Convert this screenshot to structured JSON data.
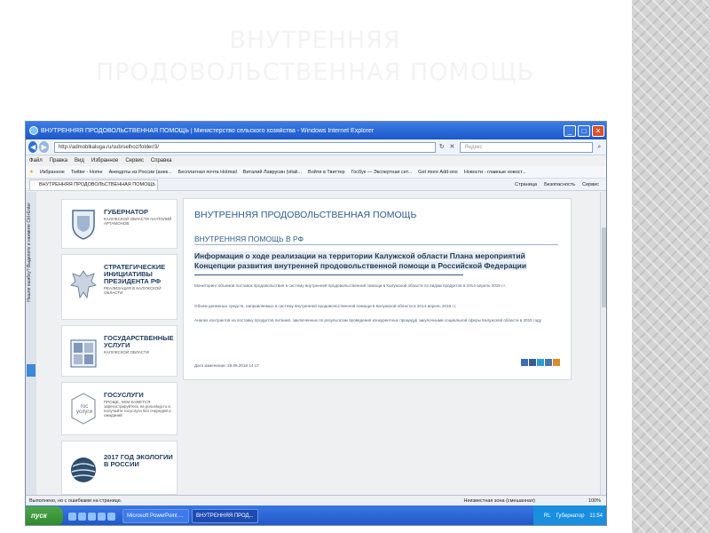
{
  "slide": {
    "title_line1": "ВНУТРЕННЯЯ",
    "title_line2": "ПРОДОВОЛЬСТВЕННАЯ ПОМОЩЬ"
  },
  "browser": {
    "window_title": "ВНУТРЕННЯЯ ПРОДОВОЛЬСТВЕННАЯ ПОМОЩЬ | Министерство сельского хозяйства - Windows Internet Explorer",
    "url": "http://admoblkaluga.ru/sub/selhoz/folder/3/",
    "search_placeholder": "Яндекс",
    "menu": [
      "Файл",
      "Правка",
      "Вид",
      "Избранное",
      "Сервис",
      "Справка"
    ],
    "favorites_label": "Избранное",
    "favorites": [
      "Twitter - Home",
      "Анекдоты из России (анек...",
      "Бесплатная почта Hotmail",
      "Виталий Лаврусин (vitali...",
      "Войти в Твиттер",
      "Госбук — Экспертная сет...",
      "Get more Add-ons",
      "Новости - главные новост..."
    ],
    "tab_label": "ВНУТРЕННЯЯ ПРОДОВОЛЬСТВЕННАЯ ПОМОЩЬ | М...",
    "tab_tools": [
      "Страница",
      "Безопасность",
      "Сервис"
    ],
    "status_text": "Выполнено, но с ошибками на странице.",
    "zone_text": "Неизвестная зона (смешанная)",
    "zoom_text": "100%"
  },
  "sidebar": {
    "vertical_text": "Нашли ошибку? Выделите и нажмите Ctrl+Enter",
    "cards": [
      {
        "heading": "ГУБЕРНАТОР",
        "sub": "КАЛУЖСКОЙ ОБЛАСТИ АНАТОЛИЙ АРТАМОНОВ"
      },
      {
        "heading": "СТРАТЕГИЧЕСКИЕ ИНИЦИАТИВЫ ПРЕЗИДЕНТА РФ",
        "sub": "РЕАЛИЗАЦИЯ В КАЛУЖСКОЙ ОБЛАСТИ"
      },
      {
        "heading": "ГОСУДАРСТВЕННЫЕ УСЛУГИ",
        "sub": "КАЛУЖСКОЙ ОБЛАСТИ"
      },
      {
        "heading": "ГОСУСЛУГИ",
        "sub": "ПРОЩЕ, ЧЕМ КАЖЕТСЯ зарегистрируйтесь на gosuslugi.ru и получайте госуслуги без очередей и ожиданий",
        "logo_text": "гос услуги"
      },
      {
        "heading": "2017 ГОД ЭКОЛОГИИ В РОССИИ",
        "sub": ""
      }
    ]
  },
  "article": {
    "page_title": "ВНУТРЕННЯЯ ПРОДОВОЛЬСТВЕННАЯ ПОМОЩЬ",
    "section_title": "ВНУТРЕННЯЯ ПОМОЩЬ В РФ",
    "headline": "Информация о ходе реализации на территории Калужской области Плана мероприятий Концепции развития внутренней продовольственной помощи в Российской Федерации",
    "para1": "Мониторинг объемов поставок продовольствия в систему внутренней продовольственной помощи в Калужской области по видам продуктов в 2014-апрель 2018 г.г.",
    "para2": "Объем денежных средств, направляемых в систему внутренней продовольственной помощи в Калужской области в 2014-апрель 2018 г.г.",
    "para3": "Анализ контрактов на поставку продуктов питания, заключенных по результатам проведения конкурентных процедур закупочными социальной сферы Калужской области в 2015 году",
    "date": "Дата изменения: 29.06.2018 14:17"
  },
  "taskbar": {
    "start_label": "пуск",
    "tasks": [
      "Microsoft PowerPoint ...",
      "ВНУТРЕННЯЯ ПРОД..."
    ],
    "lang": "RL",
    "tray_item": "Губернатор",
    "clock": "11:54"
  },
  "colors": {
    "accent": "#2c5c8f",
    "titlebar": "#1c57c9",
    "taskbar": "#1f54c4",
    "start": "#2f8a2d"
  }
}
